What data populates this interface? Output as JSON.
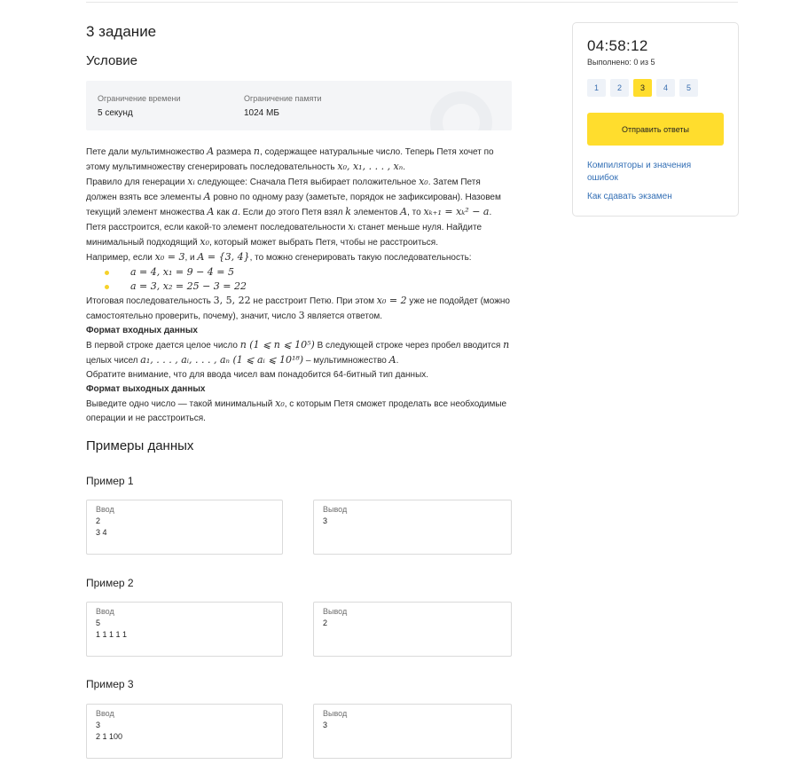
{
  "task": {
    "title": "3 задание",
    "condition_title": "Условие",
    "limits": {
      "time_label": "Ограничение времени",
      "time_value": "5 секунд",
      "memory_label": "Ограничение памяти",
      "memory_value": "1024 МБ"
    },
    "statement": {
      "p1a": "Пете дали мультимножество ",
      "p1b": "A",
      "p1c": " размера ",
      "p1d": "n",
      "p1e": ", содержащее натуральные число. Теперь Петя хочет по этому мультимножеству сгенерировать последовательность ",
      "p1f": "x₀, x₁, . . . , xₙ",
      "p1g": ".",
      "p2a": "Правило для генерации ",
      "p2b": "xᵢ",
      "p2c": " следующее: Сначала Петя выбирает положительное ",
      "p2d": "x₀",
      "p2e": ". Затем Петя должен взять все элементы ",
      "p2f": "A",
      "p2g": " ровно по одному разу (заметьте, порядок не зафиксирован). Назовем текущий элемент множества ",
      "p2h": "A",
      "p2i": " как ",
      "p2j": "a",
      "p2k": ". Если до этого Петя взял ",
      "p2l": "k",
      "p2m": " элементов ",
      "p2n": "A",
      "p2o": ", то ",
      "p2p": "xₖ₊₁ = xₖ² − a",
      "p2q": ".",
      "p3a": "Петя расстроится, если какой-то элемент последовательности ",
      "p3b": "xᵢ",
      "p3c": " станет меньше нуля. Найдите минимальный подходящий ",
      "p3d": "x₀",
      "p3e": ", который может выбрать Петя, чтобы не расстроиться.",
      "p4a": "Например, если ",
      "p4b": "x₀ = 3",
      "p4c": ", и ",
      "p4d": "A = {3, 4}",
      "p4e": ", то можно сгенерировать такую последовательность:",
      "li1": "a = 4, x₁ = 9 − 4 = 5",
      "li2": "a = 3, x₂ = 25 − 3 = 22",
      "p5a": "Итоговая последовательность ",
      "p5b": "3, 5, 22",
      "p5c": " не расстроит Петю. При этом ",
      "p5d": "x₀ = 2",
      "p5e": " уже не подойдет (можно самостоятельно проверить, почему), значит, число ",
      "p5f": "3",
      "p5g": " является ответом.",
      "input_title": "Формат входных данных",
      "p6a": "В первой строке дается целое число ",
      "p6b": "n (1 ⩽ n ⩽ 10⁵)",
      "p6c": " В следующей строке через пробел вводится ",
      "p6d": "n",
      "p6e": " целых чисел ",
      "p6f": "a₁, . . . , aᵢ, . . . , aₙ (1 ⩽ aᵢ ⩽ 10¹⁸)",
      "p6g": " – мультимножество ",
      "p6h": "A",
      "p6i": ".",
      "p7": "Обратите внимание, что для ввода чисел вам понадобится 64-битный тип данных.",
      "output_title": "Формат выходных данных",
      "p8a": "Выведите одно число — такой минимальный ",
      "p8b": "x₀",
      "p8c": ", с которым Петя сможет проделать все необходимые операции и не расстроиться."
    }
  },
  "examples": {
    "title": "Примеры данных",
    "input_label": "Ввод",
    "output_label": "Вывод",
    "items": [
      {
        "title": "Пример 1",
        "input_line1": "2",
        "input_line2": "3 4",
        "output": "3"
      },
      {
        "title": "Пример 2",
        "input_line1": "5",
        "input_line2": "1 1 1 1 1",
        "output": "2"
      },
      {
        "title": "Пример 3",
        "input_line1": "3",
        "input_line2": "2 1 100",
        "output": "3"
      }
    ]
  },
  "sidebar": {
    "timer": "04:58:12",
    "done": "Выполнено: 0 из 5",
    "tasks": [
      "1",
      "2",
      "3",
      "4",
      "5"
    ],
    "active_task": "3",
    "submit_label": "Отправить ответы",
    "link_compilers": "Компиляторы и значения ошибок",
    "link_how": "Как сдавать экзамен",
    "accent_color": "#ffdd2d",
    "link_color": "#336fb5"
  }
}
